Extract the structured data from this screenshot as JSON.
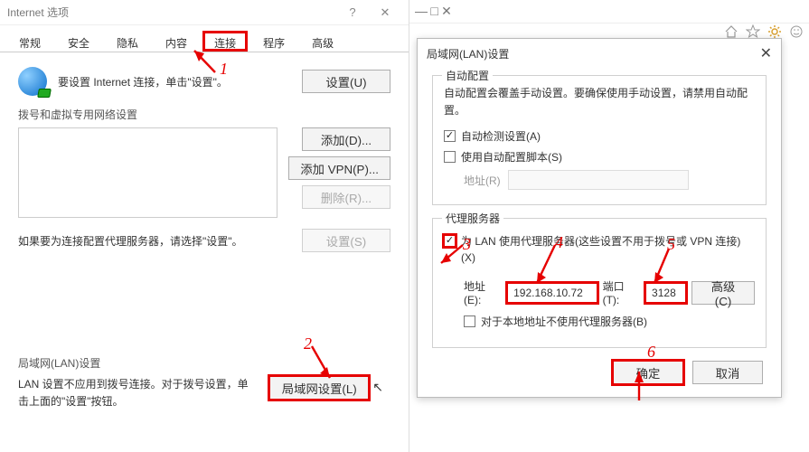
{
  "left": {
    "title": "Internet 选项",
    "tabs": [
      "常规",
      "安全",
      "隐私",
      "内容",
      "连接",
      "程序",
      "高级"
    ],
    "active_tab_index": 4,
    "setup_text": "要设置 Internet 连接，单击\"设置\"。",
    "setup_btn": "设置(U)",
    "dial_group_title": "拨号和虚拟专用网络设置",
    "add_btn": "添加(D)...",
    "add_vpn_btn": "添加 VPN(P)...",
    "remove_btn": "删除(R)...",
    "proxy_note": "如果要为连接配置代理服务器，请选择\"设置\"。",
    "settings_btn": "设置(S)",
    "lan_group_title": "局域网(LAN)设置",
    "lan_note": "LAN 设置不应用到拨号连接。对于拨号设置，单击上面的\"设置\"按钮。",
    "lan_settings_btn": "局域网设置(L)"
  },
  "lan": {
    "title": "局域网(LAN)设置",
    "auto_legend": "自动配置",
    "auto_note": "自动配置会覆盖手动设置。要确保使用手动设置，请禁用自动配置。",
    "auto_detect_label": "自动检测设置(A)",
    "auto_detect_checked": true,
    "use_script_label": "使用自动配置脚本(S)",
    "use_script_checked": false,
    "script_addr_label": "地址(R)",
    "proxy_legend": "代理服务器",
    "use_proxy_label": "为 LAN 使用代理服务器(这些设置不用于拨号或 VPN 连接)(X)",
    "use_proxy_checked": true,
    "addr_label": "地址(E):",
    "addr_value": "192.168.10.72",
    "port_label": "端口(T):",
    "port_value": "3128",
    "advanced_btn": "高级(C)",
    "bypass_local_label": "对于本地地址不使用代理服务器(B)",
    "bypass_local_checked": false,
    "ok_btn": "确定",
    "cancel_btn": "取消"
  },
  "annotations": {
    "n1": "1",
    "n2": "2",
    "n3": "3",
    "n4": "4",
    "n5": "5",
    "n6": "6"
  }
}
